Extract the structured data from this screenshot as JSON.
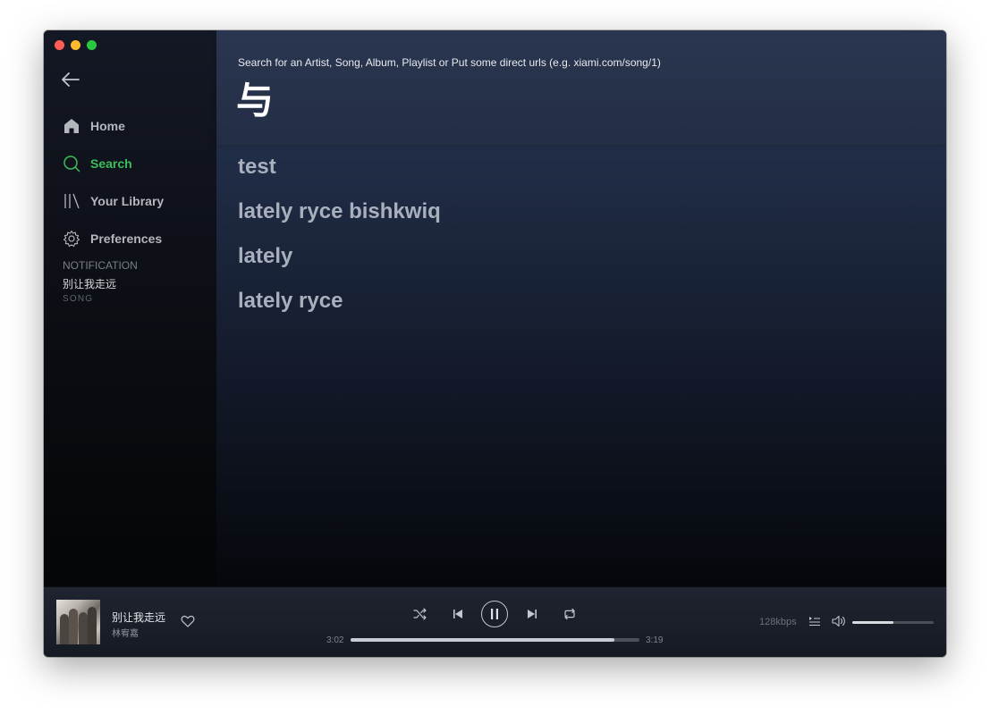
{
  "sidebar": {
    "back_icon": "arrow-left-icon",
    "items": [
      {
        "label": "Home",
        "icon": "home-icon",
        "active": false
      },
      {
        "label": "Search",
        "icon": "search-icon",
        "active": true
      },
      {
        "label": "Your Library",
        "icon": "library-icon",
        "active": false
      },
      {
        "label": "Preferences",
        "icon": "gear-icon",
        "active": false
      }
    ],
    "notification": {
      "label": "NOTIFICATION",
      "title": "别让我走远",
      "type": "SONG"
    }
  },
  "search": {
    "hint": "Search for an Artist, Song, Album, Playlist or Put some direct urls (e.g. xiami.com/song/1)",
    "query": "与",
    "suggestions": [
      "test",
      "lately ryce bishkwiq",
      "lately",
      "lately ryce"
    ]
  },
  "player": {
    "track_title": "别让我走远",
    "track_artist": "林宥嘉",
    "time_current": "3:02",
    "time_total": "3:19",
    "progress": 0.913,
    "bitrate": "128kbps",
    "volume": 0.5,
    "state": "playing"
  },
  "colors": {
    "accent": "#3cbd5a",
    "sidebar_text": "#b3b6bd",
    "suggestion_text": "#a9b0bd"
  }
}
